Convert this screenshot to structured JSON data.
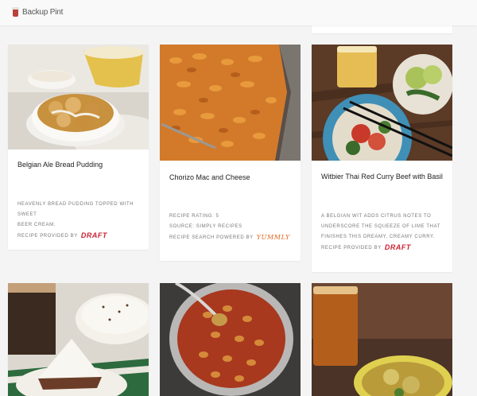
{
  "header": {
    "logo_text": "Backup Pint",
    "logo_icon": "pint-glass-icon"
  },
  "cards": [
    {
      "title": "Belgian Ale Bread Pudding",
      "desc_line1": "Heavenly bread pudding topped with sweet",
      "desc_line2": "beer cream.",
      "provider_label": "Recipe provided by",
      "provider_brand": "DRAFT"
    },
    {
      "title": "Chorizo Mac and Cheese",
      "rating": "Recipe rating: 5",
      "source": "Source: Simply Recipes",
      "powered_label": "Recipe search powered by",
      "powered_brand": "Yummly"
    },
    {
      "title": "Witbier Thai Red Curry Beef with Basil",
      "desc_line1": "A Belgian wit adds citrus notes to",
      "desc_line2": "underscore the squeeze of lime that",
      "desc_line3": "finishes this dreamy, creamy curry.",
      "provider_label": "Recipe provided by",
      "provider_brand": "DRAFT"
    },
    {
      "title": ""
    },
    {
      "title": ""
    },
    {
      "title": ""
    }
  ]
}
